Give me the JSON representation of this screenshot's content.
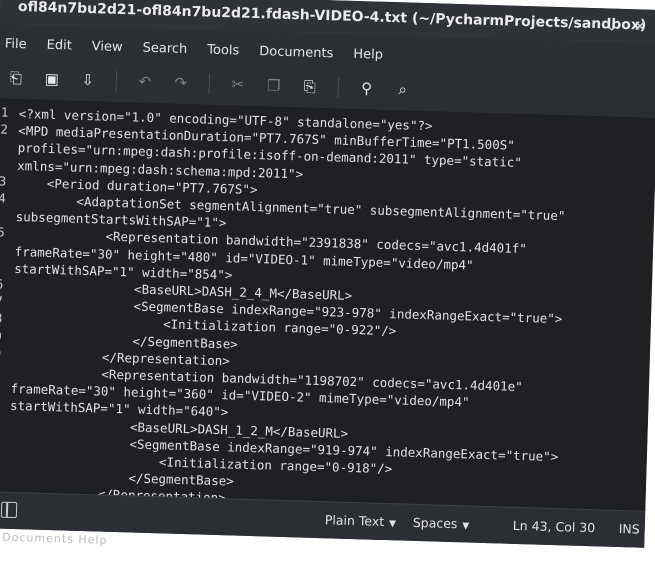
{
  "window": {
    "title": "ofl84n7bu2d21-ofl84n7bu2d21.fdash-VIDEO-4.txt (~/PycharmProjects/sandbox)",
    "minimize_glyph": "⌄",
    "close_glyph": "✕"
  },
  "menu": {
    "file": "File",
    "edit": "Edit",
    "view": "View",
    "search": "Search",
    "tools": "Tools",
    "documents": "Documents",
    "help": "Help"
  },
  "toolbar": {
    "icons": [
      "new-document-icon",
      "open-document-icon",
      "save-document-icon",
      "undo-icon",
      "redo-icon",
      "cut-icon",
      "copy-icon",
      "paste-icon",
      "search-icon",
      "replace-icon"
    ],
    "glyphs": {
      "new": "⎗",
      "open": "▣",
      "save": "⇩",
      "undo": "↶",
      "redo": "↷",
      "cut": "✂",
      "copy": "❐",
      "paste": "⎘",
      "find": "⚲",
      "replace": "⌕"
    }
  },
  "editor": {
    "line_numbers": [
      "1",
      "2",
      "",
      "",
      "3",
      "4",
      "",
      "5",
      "",
      "",
      "6",
      "7",
      "8",
      "9",
      "0",
      "1",
      "",
      "",
      "2",
      "3",
      "4",
      "5",
      "6"
    ],
    "lines": [
      "<?xml version=\"1.0\" encoding=\"UTF-8\" standalone=\"yes\"?>",
      "<MPD mediaPresentationDuration=\"PT7.767S\" minBufferTime=\"PT1.500S\"",
      "profiles=\"urn:mpeg:dash:profile:isoff-on-demand:2011\" type=\"static\"",
      "xmlns=\"urn:mpeg:dash:schema:mpd:2011\">",
      "    <Period duration=\"PT7.767S\">",
      "        <AdaptationSet segmentAlignment=\"true\" subsegmentAlignment=\"true\"",
      "subsegmentStartsWithSAP=\"1\">",
      "            <Representation bandwidth=\"2391838\" codecs=\"avc1.4d401f\"",
      "frameRate=\"30\" height=\"480\" id=\"VIDEO-1\" mimeType=\"video/mp4\"",
      "startWithSAP=\"1\" width=\"854\">",
      "                <BaseURL>DASH_2_4_M</BaseURL>",
      "                <SegmentBase indexRange=\"923-978\" indexRangeExact=\"true\">",
      "                    <Initialization range=\"0-922\"/>",
      "                </SegmentBase>",
      "            </Representation>",
      "            <Representation bandwidth=\"1198702\" codecs=\"avc1.4d401e\"",
      "frameRate=\"30\" height=\"360\" id=\"VIDEO-2\" mimeType=\"video/mp4\"",
      "startWithSAP=\"1\" width=\"640\">",
      "                <BaseURL>DASH_1_2_M</BaseURL>",
      "                <SegmentBase indexRange=\"919-974\" indexRangeExact=\"true\">",
      "                    <Initialization range=\"0-918\"/>",
      "                </SegmentBase>",
      "            </Representation>"
    ]
  },
  "statusbar": {
    "syntax": "Plain Text",
    "indent": "Spaces",
    "position": "Ln 43, Col 30",
    "mode": "INS"
  },
  "below_window": "Documents  Help"
}
